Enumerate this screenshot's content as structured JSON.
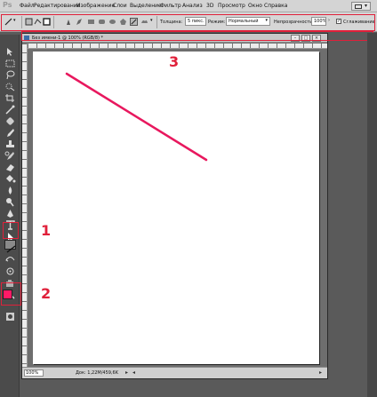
{
  "app": {
    "logo": "Ps"
  },
  "menu": {
    "items": [
      "Файл",
      "Редактирование",
      "Изображение",
      "Слои",
      "Выделение",
      "Фильтр",
      "Анализ",
      "3D",
      "Просмотр",
      "Окно",
      "Справка"
    ]
  },
  "options": {
    "thickness_label": "Толщина:",
    "thickness_value": "5 пикс.",
    "mode_label": "Режим:",
    "mode_value": "Нормальный",
    "opacity_label": "Непрозрачность:",
    "opacity_value": "100%",
    "antialias_label": "Сглаживание",
    "antialias_checked": "✓"
  },
  "document": {
    "title": "Без имени-1 @ 100% (RGB/8) *",
    "zoom": "100%",
    "doc_info": "Док: 1,22M/459,6K"
  },
  "annotations": [
    "1",
    "2",
    "3"
  ],
  "colors": {
    "annotation": "#e0203a",
    "foreground": "#ff1a66",
    "stroke": "#e8185e",
    "background": "#ffffff"
  },
  "line": {
    "icon": "line-tool-icon"
  }
}
